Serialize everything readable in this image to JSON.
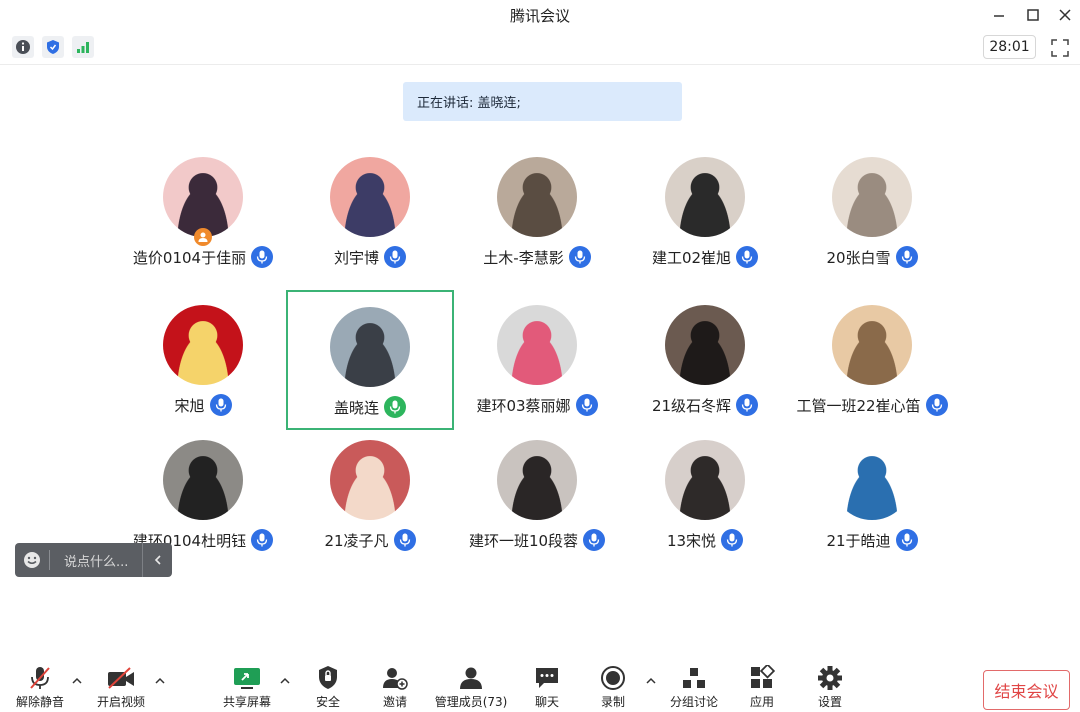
{
  "window": {
    "title": "腾讯会议"
  },
  "topbar": {
    "timer": "28:01"
  },
  "speaking": {
    "text": "正在讲话: 盖晓连;"
  },
  "participants": [
    {
      "name": "造价0104于佳丽",
      "host": true,
      "mic": "blue"
    },
    {
      "name": "刘宇博",
      "host": false,
      "mic": "blue"
    },
    {
      "name": "土木-李慧影",
      "host": false,
      "mic": "blue"
    },
    {
      "name": "建工02崔旭",
      "host": false,
      "mic": "blue"
    },
    {
      "name": "20张白雪",
      "host": false,
      "mic": "blue"
    },
    {
      "name": "宋旭",
      "host": false,
      "mic": "blue"
    },
    {
      "name": "盖晓连",
      "host": false,
      "mic": "green",
      "active": true
    },
    {
      "name": "建环03蔡丽娜",
      "host": false,
      "mic": "blue"
    },
    {
      "name": "21级石冬辉",
      "host": false,
      "mic": "blue"
    },
    {
      "name": "工管一班22崔心笛",
      "host": false,
      "mic": "blue"
    },
    {
      "name": "建环0104杜明钰",
      "host": false,
      "mic": "blue"
    },
    {
      "name": "21凌子凡",
      "host": false,
      "mic": "blue"
    },
    {
      "name": "建环一班10段蓉",
      "host": false,
      "mic": "blue"
    },
    {
      "name": "13宋悦",
      "host": false,
      "mic": "blue"
    },
    {
      "name": "21于皓迪",
      "host": false,
      "mic": "blue"
    }
  ],
  "chat": {
    "placeholder": "说点什么..."
  },
  "toolbar": {
    "unmute": "解除静音",
    "video": "开启视频",
    "share": "共享屏幕",
    "security": "安全",
    "invite": "邀请",
    "members": "管理成员(73)",
    "chat": "聊天",
    "record": "录制",
    "breakout": "分组讨论",
    "apps": "应用",
    "settings": "设置",
    "end": "结束会议"
  },
  "colors": {
    "accent_blue": "#2f6fe4",
    "speaking_green": "#2db55d",
    "speaking_bg": "#dbeafc",
    "end_red": "#e04545"
  }
}
